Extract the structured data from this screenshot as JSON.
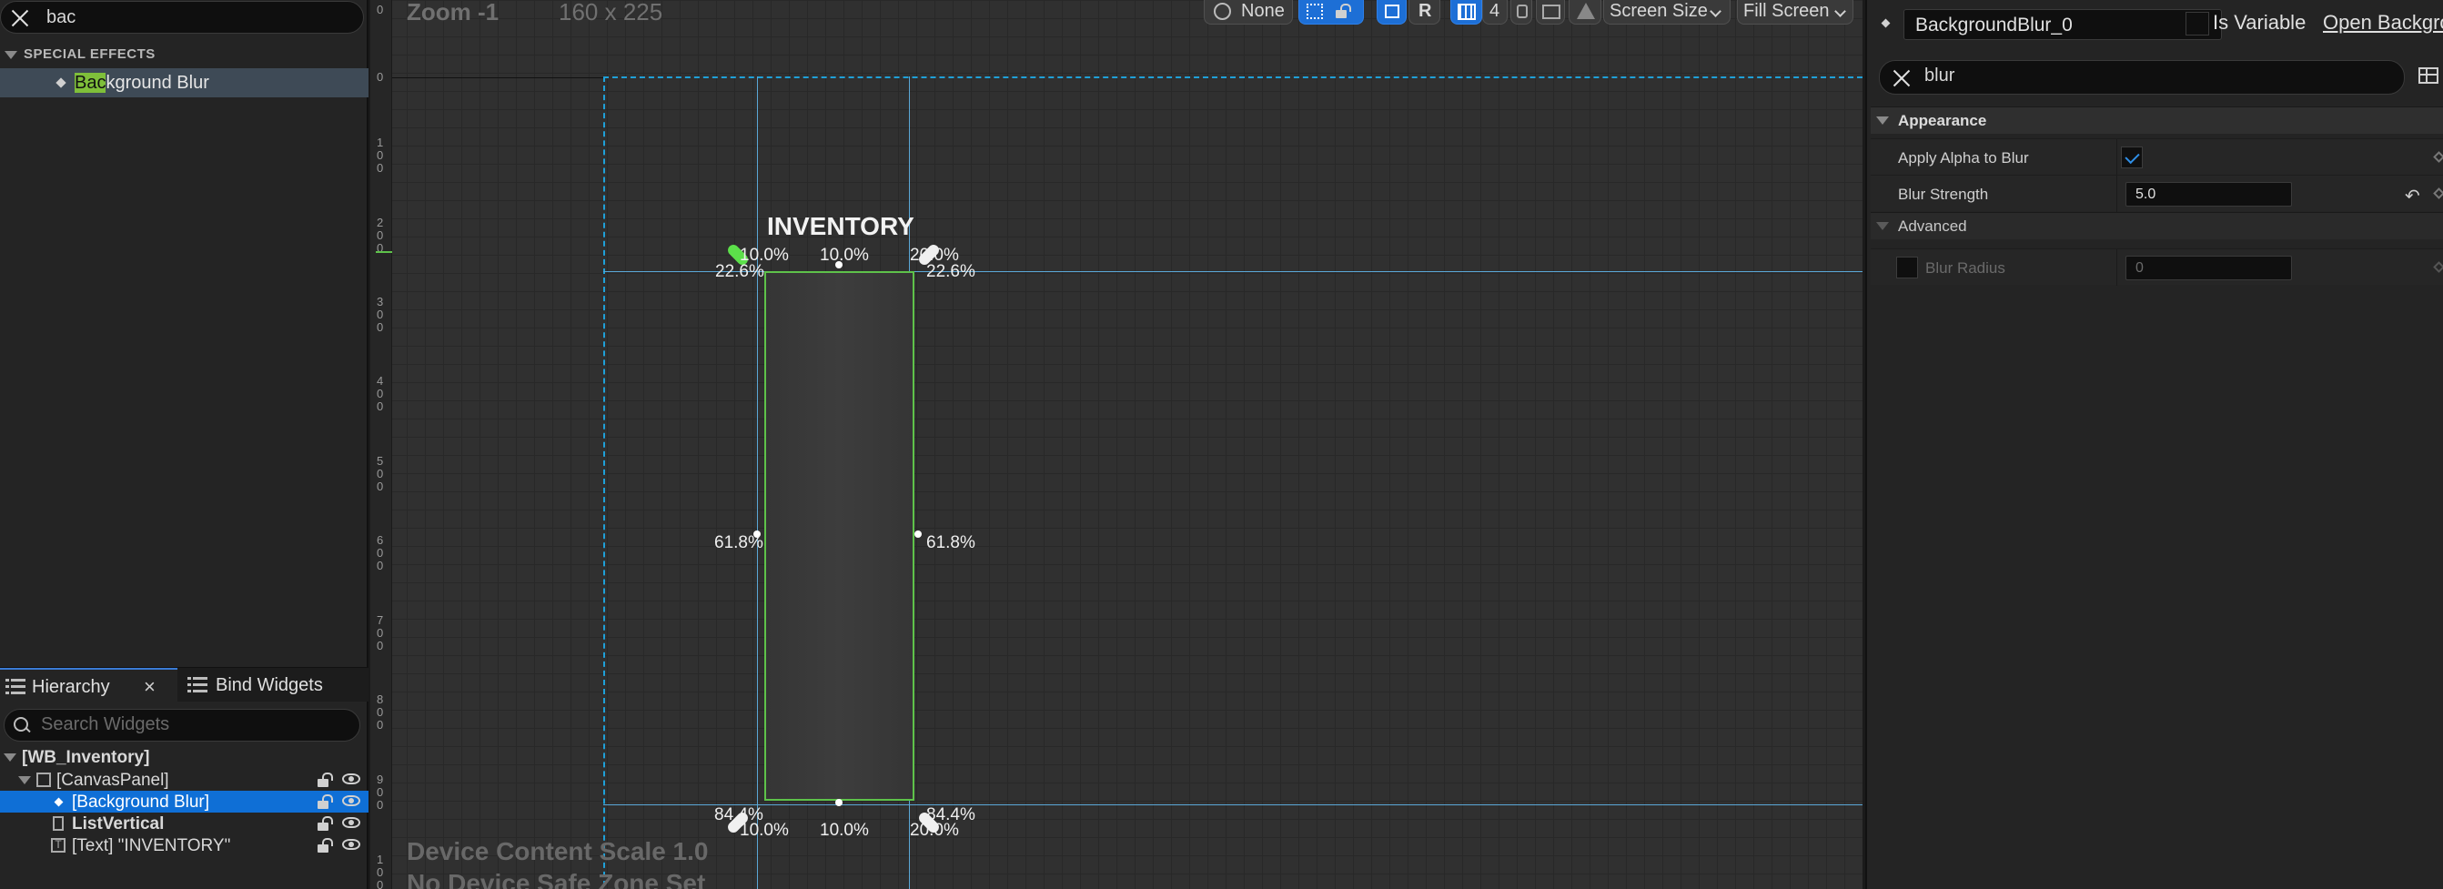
{
  "palette": {
    "search_value": "bac",
    "category": "SPECIAL EFFECTS",
    "item_match": "Bac",
    "item_rest": "kground Blur"
  },
  "tabs": {
    "hierarchy": "Hierarchy",
    "bind_widgets": "Bind Widgets",
    "close": "×"
  },
  "hierarchy": {
    "search_placeholder": "Search Widgets",
    "rows": [
      {
        "label": "[WB_Inventory]"
      },
      {
        "label": "[CanvasPanel]"
      },
      {
        "label": "[Background Blur]"
      },
      {
        "label": "ListVertical"
      },
      {
        "label": "[Text] \"INVENTORY\""
      }
    ]
  },
  "canvas": {
    "zoom": "Zoom -1",
    "resolution": "160 x 225",
    "content_scale": "Device Content Scale 1.0",
    "safe_zone": "No Device Safe Zone Set",
    "ruler": [
      "0",
      "0",
      "1 0 0",
      "2 0 0",
      "3 0 0",
      "4 0 0",
      "5 0 0",
      "6 0 0",
      "7 0 0",
      "8 0 0",
      "9 0 0",
      "1 0 0"
    ],
    "toolbar": {
      "preview": "None",
      "grid_size": "4",
      "r_label": "R",
      "screen_size": "Screen Size",
      "fill_screen": "Fill Screen"
    },
    "widget_title": "INVENTORY",
    "percent_top": [
      "10.0%",
      "10.0%",
      "20.0%"
    ],
    "percent_top_side": [
      "22.6%",
      "22.6%"
    ],
    "percent_mid": [
      "61.8%",
      "61.8%"
    ],
    "percent_bottom_side": [
      "84.4%",
      "84.4%"
    ],
    "percent_bottom": [
      "10.0%",
      "10.0%",
      "20.0%"
    ]
  },
  "details": {
    "name": "BackgroundBlur_0",
    "is_variable": "Is Variable",
    "open_bg": "Open Background",
    "search_value": "blur",
    "sections": {
      "appearance": "Appearance",
      "advanced": "Advanced"
    },
    "props": {
      "apply_alpha": "Apply Alpha to Blur",
      "blur_strength": "Blur Strength",
      "blur_strength_value": "5.0",
      "blur_radius": "Blur Radius",
      "blur_radius_value": "0"
    }
  },
  "colors": {
    "selection": "#0f6fd6",
    "match_highlight": "#7fbf3a",
    "widget_outline": "#5ec24a",
    "guides": "#5aa7d6"
  }
}
